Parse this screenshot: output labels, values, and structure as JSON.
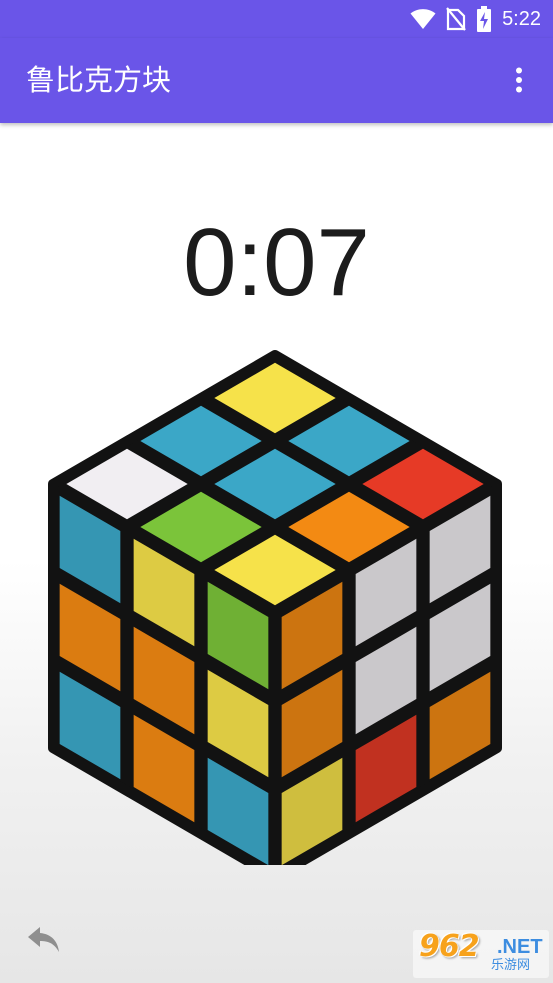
{
  "status_bar": {
    "time": "5:22",
    "icons": [
      "wifi-icon",
      "no-sim-icon",
      "battery-charging-icon"
    ]
  },
  "app_bar": {
    "title": "鲁比克方块",
    "menu_icon": "more-vert-icon"
  },
  "timer": {
    "value": "0:07"
  },
  "cube": {
    "top_face": [
      [
        "blue",
        "yellow",
        "blue"
      ],
      [
        "white",
        "blue",
        "red"
      ],
      [
        "green",
        "yellow",
        "orange"
      ]
    ],
    "left_face": [
      [
        "blue",
        "yellow",
        "green"
      ],
      [
        "orange",
        "orange",
        "yellow"
      ],
      [
        "blue",
        "orange",
        "blue"
      ]
    ],
    "right_face": [
      [
        "orange",
        "white",
        "white"
      ],
      [
        "orange",
        "white",
        "white"
      ],
      [
        "yellow",
        "red",
        "orange"
      ]
    ],
    "colors": {
      "yellow": "#f6e24a",
      "blue": "#3ba7c7",
      "white": "#f1eef2",
      "red": "#e63a26",
      "green": "#7bc43a",
      "orange": "#f38a13"
    }
  },
  "controls": {
    "undo_icon": "undo-icon"
  },
  "watermark": {
    "number": "962",
    "domain": ".NET",
    "subtitle": "乐游网"
  },
  "theme": {
    "accent": "#6a55e8"
  }
}
